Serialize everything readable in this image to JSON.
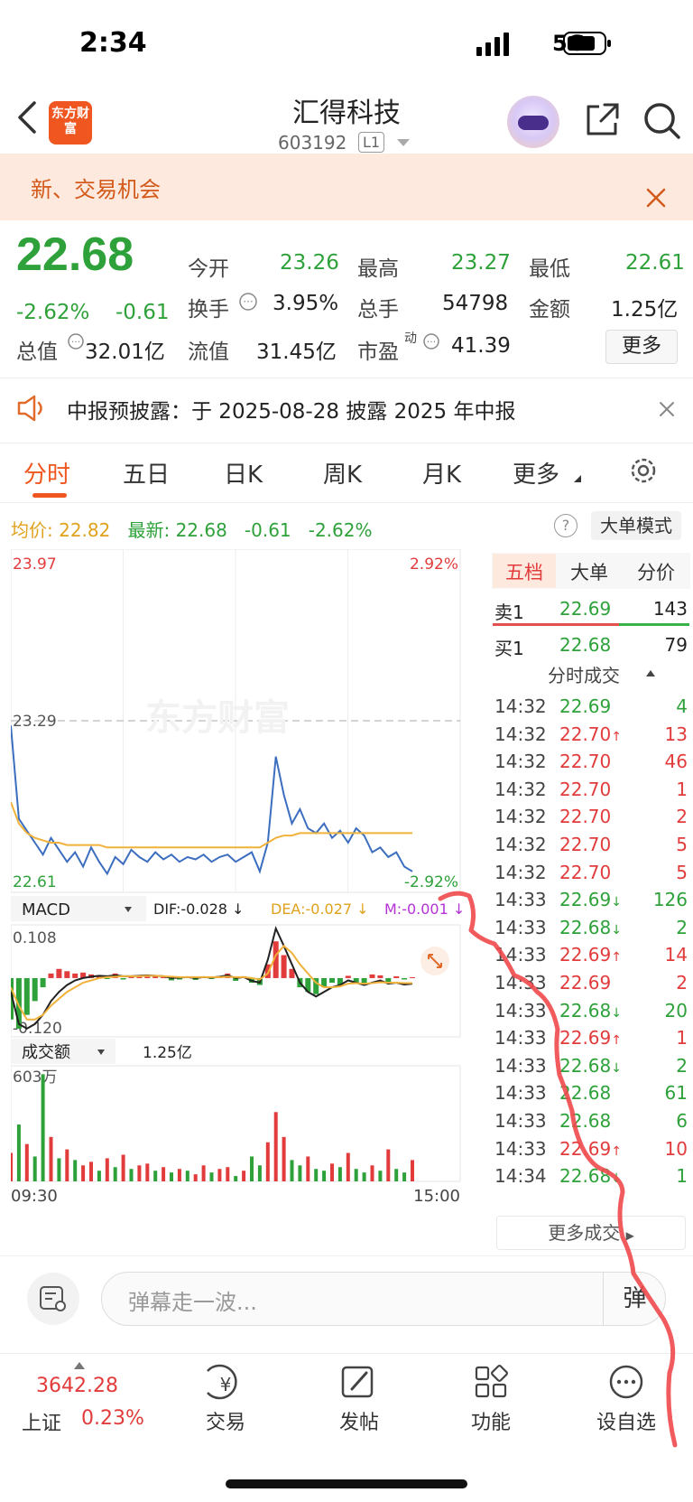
{
  "status_bar": {
    "time": "2:34",
    "network": "5G"
  },
  "header": {
    "logo_text": "东方财富",
    "stock_name": "汇得科技",
    "stock_code": "603192",
    "level": "L1"
  },
  "banner": {
    "text": "新、交易机会"
  },
  "quote": {
    "price": "22.68",
    "change_pct": "-2.62%",
    "change": "-0.61",
    "stats": [
      {
        "label": "今开",
        "value": "23.26",
        "tone": "green"
      },
      {
        "label": "最高",
        "value": "23.27",
        "tone": "green"
      },
      {
        "label": "最低",
        "value": "22.61",
        "tone": "green"
      },
      {
        "label": "换手",
        "value": "3.95%",
        "tone": "dark"
      },
      {
        "label": "总手",
        "value": "54798",
        "tone": "dark"
      },
      {
        "label": "金额",
        "value": "1.25亿",
        "tone": "dark"
      },
      {
        "label": "总值",
        "value": "32.01亿",
        "tone": "dark"
      },
      {
        "label": "流值",
        "value": "31.45亿",
        "tone": "dark"
      },
      {
        "label": "市盈",
        "sup": "动",
        "value": "41.39",
        "tone": "dark"
      }
    ],
    "more_label": "更多"
  },
  "notice": {
    "text": "中报预披露：于 2025-08-28 披露 2025 年中报"
  },
  "period_tabs": [
    "分时",
    "五日",
    "日K",
    "周K",
    "月K",
    "更多"
  ],
  "avg_row": {
    "avg_label": "均价:",
    "avg_value": "22.82",
    "latest_label": "最新:",
    "latest_value": "22.68",
    "latest_change": "-0.61",
    "latest_pct": "-2.62%",
    "bigorder_label": "大单模式"
  },
  "chart_data": {
    "type": "line",
    "title": "",
    "price_axis": {
      "top": "23.97",
      "mid": "23.29",
      "bottom": "22.61",
      "top_pct": "2.92%",
      "bottom_pct": "-2.92%"
    },
    "ylim": [
      22.61,
      23.97
    ],
    "reference": 23.29,
    "watermark": "东方财富",
    "series": [
      {
        "name": "price",
        "color": "#3c6ebf",
        "values": [
          23.27,
          22.88,
          22.83,
          22.78,
          22.73,
          22.8,
          22.75,
          22.7,
          22.74,
          22.68,
          22.76,
          22.7,
          22.65,
          22.72,
          22.69,
          22.75,
          22.72,
          22.7,
          22.74,
          22.71,
          22.73,
          22.7,
          22.72,
          22.71,
          22.73,
          22.7,
          22.72,
          22.73,
          22.7,
          22.72,
          22.74,
          22.66,
          22.78,
          23.14,
          22.98,
          22.86,
          22.92,
          22.84,
          22.82,
          22.86,
          22.8,
          22.83,
          22.78,
          22.84,
          22.81,
          22.74,
          22.76,
          22.72,
          22.74,
          22.68,
          22.66
        ]
      },
      {
        "name": "avg",
        "color": "#f0b23a",
        "values": [
          22.95,
          22.86,
          22.82,
          22.8,
          22.79,
          22.78,
          22.78,
          22.77,
          22.77,
          22.77,
          22.77,
          22.77,
          22.76,
          22.76,
          22.76,
          22.76,
          22.76,
          22.76,
          22.76,
          22.76,
          22.76,
          22.76,
          22.76,
          22.76,
          22.76,
          22.76,
          22.76,
          22.76,
          22.76,
          22.76,
          22.76,
          22.76,
          22.78,
          22.8,
          22.81,
          22.81,
          22.82,
          22.82,
          22.82,
          22.82,
          22.82,
          22.82,
          22.82,
          22.82,
          22.82,
          22.82,
          22.82,
          22.82,
          22.82,
          22.82,
          22.82
        ]
      }
    ],
    "macd": {
      "label": "MACD",
      "dif_label": "DIF:-0.028 ↓",
      "dea_label": "DEA:-0.027 ↓",
      "m_label": "M:-0.001 ↓",
      "ymax_label": "0.108",
      "ymin_label": "-0.120",
      "bars": [
        -0.09,
        -0.11,
        -0.08,
        -0.05,
        -0.02,
        0.01,
        0.02,
        0.015,
        0.01,
        0.012,
        0.008,
        0.005,
        -0.002,
        0.01,
        -0.003,
        0.004,
        0.006,
        0.003,
        0.005,
        0.002,
        -0.005,
        -0.003,
        0.002,
        -0.004,
        0.003,
        -0.002,
        0.004,
        0.01,
        -0.006,
        0.004,
        -0.01,
        -0.015,
        0.03,
        0.08,
        0.05,
        0.02,
        -0.02,
        -0.03,
        -0.035,
        -0.02,
        -0.01,
        -0.015,
        0.005,
        -0.01,
        -0.012,
        0.008,
        0.006,
        -0.008,
        0.004,
        -0.003,
        0.002
      ],
      "dif": [
        -0.03,
        -0.1,
        -0.11,
        -0.1,
        -0.08,
        -0.05,
        -0.03,
        -0.015,
        -0.005,
        0.0,
        0.003,
        0.005,
        0.004,
        0.006,
        0.004,
        0.004,
        0.005,
        0.006,
        0.005,
        0.004,
        0.0,
        0.001,
        0.002,
        0.0,
        0.002,
        0.001,
        0.003,
        0.006,
        0.0,
        0.002,
        -0.006,
        -0.01,
        0.04,
        0.108,
        0.07,
        0.03,
        -0.01,
        -0.03,
        -0.04,
        -0.03,
        -0.02,
        -0.015,
        -0.005,
        -0.01,
        -0.015,
        -0.01,
        -0.005,
        -0.012,
        -0.01,
        -0.014,
        -0.012
      ],
      "dea": [
        -0.02,
        -0.06,
        -0.09,
        -0.09,
        -0.08,
        -0.06,
        -0.045,
        -0.03,
        -0.02,
        -0.01,
        -0.005,
        0.0,
        0.002,
        0.003,
        0.004,
        0.004,
        0.004,
        0.005,
        0.005,
        0.004,
        0.003,
        0.002,
        0.002,
        0.002,
        0.002,
        0.002,
        0.002,
        0.003,
        0.002,
        0.002,
        0.0,
        -0.003,
        0.01,
        0.05,
        0.07,
        0.055,
        0.03,
        0.01,
        -0.01,
        -0.02,
        -0.02,
        -0.018,
        -0.012,
        -0.011,
        -0.012,
        -0.011,
        -0.009,
        -0.01,
        -0.01,
        -0.011,
        -0.011
      ]
    },
    "volume": {
      "label": "成交额",
      "total": "1.25亿",
      "ymax_label": "603万",
      "x_start": "09:30",
      "x_end": "15:00",
      "values": [
        1.6,
        3.2,
        2.1,
        1.4,
        6.03,
        2.5,
        1.3,
        1.8,
        1.2,
        0.9,
        1.1,
        0.6,
        1.3,
        0.8,
        1.5,
        0.7,
        0.9,
        1.0,
        0.6,
        0.8,
        0.5,
        0.7,
        0.6,
        0.4,
        0.9,
        0.5,
        0.7,
        0.8,
        0.3,
        0.6,
        1.4,
        0.9,
        2.2,
        3.9,
        2.5,
        1.2,
        0.9,
        1.4,
        0.7,
        0.6,
        1.0,
        0.8,
        1.6,
        0.7,
        0.5,
        0.9,
        0.6,
        1.8,
        0.7,
        0.5,
        1.2
      ],
      "up": [
        true,
        false,
        true,
        false,
        false,
        true,
        false,
        true,
        false,
        true,
        true,
        false,
        true,
        false,
        true,
        false,
        true,
        true,
        false,
        true,
        false,
        true,
        false,
        true,
        true,
        false,
        true,
        true,
        false,
        true,
        false,
        false,
        true,
        true,
        true,
        false,
        false,
        true,
        false,
        false,
        true,
        false,
        true,
        false,
        false,
        true,
        false,
        true,
        false,
        false,
        true
      ]
    }
  },
  "order_book": {
    "tabs": [
      "五档",
      "大单",
      "分价"
    ],
    "sell1": {
      "label": "卖1",
      "price": "22.69",
      "volume": "143"
    },
    "buy1": {
      "label": "买1",
      "price": "22.68",
      "volume": "79"
    },
    "trades_title": "分时成交",
    "trades": [
      {
        "time": "14:32",
        "price": "22.69",
        "arrow": "",
        "vol": "4",
        "tone": "green"
      },
      {
        "time": "14:32",
        "price": "22.70",
        "arrow": "↑",
        "vol": "13",
        "tone": "red"
      },
      {
        "time": "14:32",
        "price": "22.70",
        "arrow": "",
        "vol": "46",
        "tone": "red"
      },
      {
        "time": "14:32",
        "price": "22.70",
        "arrow": "",
        "vol": "1",
        "tone": "red"
      },
      {
        "time": "14:32",
        "price": "22.70",
        "arrow": "",
        "vol": "2",
        "tone": "red"
      },
      {
        "time": "14:32",
        "price": "22.70",
        "arrow": "",
        "vol": "5",
        "tone": "red"
      },
      {
        "time": "14:32",
        "price": "22.70",
        "arrow": "",
        "vol": "5",
        "tone": "red"
      },
      {
        "time": "14:33",
        "price": "22.69",
        "arrow": "↓",
        "vol": "126",
        "tone": "green"
      },
      {
        "time": "14:33",
        "price": "22.68",
        "arrow": "↓",
        "vol": "2",
        "tone": "green"
      },
      {
        "time": "14:33",
        "price": "22.69",
        "arrow": "↑",
        "vol": "14",
        "tone": "red"
      },
      {
        "time": "14:33",
        "price": "22.69",
        "arrow": "",
        "vol": "2",
        "tone": "red"
      },
      {
        "time": "14:33",
        "price": "22.68",
        "arrow": "↓",
        "vol": "20",
        "tone": "green"
      },
      {
        "time": "14:33",
        "price": "22.69",
        "arrow": "↑",
        "vol": "1",
        "tone": "red"
      },
      {
        "time": "14:33",
        "price": "22.68",
        "arrow": "↓",
        "vol": "2",
        "tone": "green"
      },
      {
        "time": "14:33",
        "price": "22.68",
        "arrow": "",
        "vol": "61",
        "tone": "green"
      },
      {
        "time": "14:33",
        "price": "22.68",
        "arrow": "",
        "vol": "6",
        "tone": "green"
      },
      {
        "time": "14:33",
        "price": "22.69",
        "arrow": "↑",
        "vol": "10",
        "tone": "red"
      },
      {
        "time": "14:34",
        "price": "22.68",
        "arrow": "↓",
        "vol": "1",
        "tone": "green"
      }
    ],
    "more_label": "更多成交"
  },
  "danmaku": {
    "placeholder": "弹幕走一波...",
    "send_label": "弹"
  },
  "bottom_nav": {
    "index_value": "3642.28",
    "index_name": "上证",
    "index_pct": "0.23%",
    "items": [
      "交易",
      "发帖",
      "功能",
      "设自选"
    ]
  },
  "colors": {
    "up": "#e23b3b",
    "down": "#2ea13a",
    "accent": "#f0561f",
    "price_line": "#3c6ebf",
    "avg_line": "#f0b23a"
  }
}
